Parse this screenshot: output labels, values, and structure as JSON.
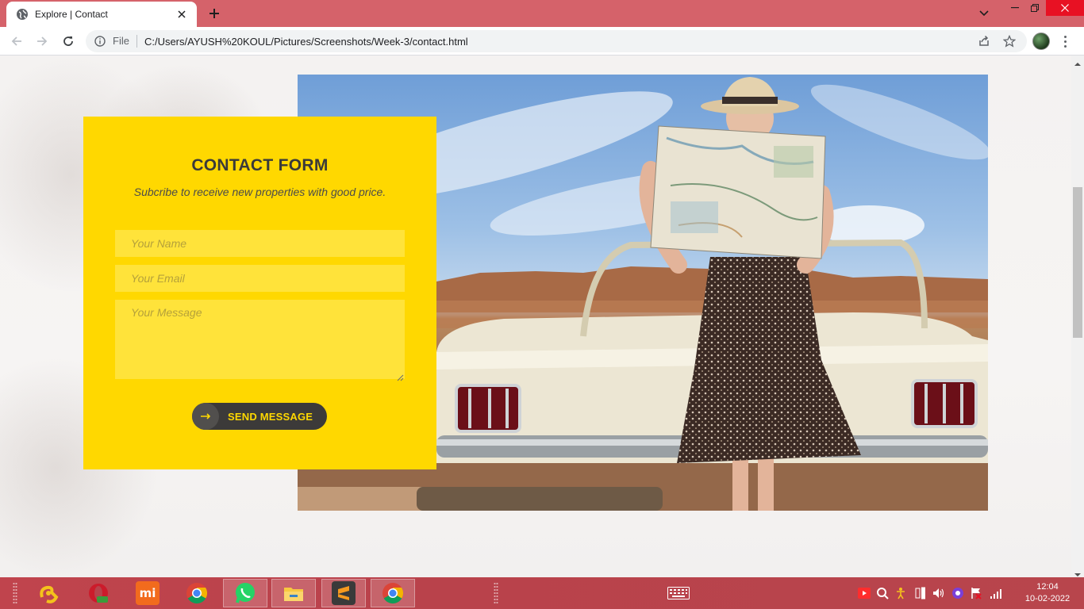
{
  "browser": {
    "tab_title": "Explore | Contact",
    "omnibox_scheme": "File",
    "url": "C:/Users/AYUSH%20KOUL/Pictures/Screenshots/Week-3/contact.html"
  },
  "contact_form": {
    "title": "CONTACT FORM",
    "subtitle": "Subcribe to receive new properties with good price.",
    "name_placeholder": "Your Name",
    "email_placeholder": "Your Email",
    "message_placeholder": "Your Message",
    "submit_label": "SEND MESSAGE",
    "accent_color": "#ffd800",
    "button_color": "#3c3a39"
  },
  "taskbar": {
    "apps": [
      "cheat-engine",
      "opera",
      "mi",
      "chrome",
      "whatsapp",
      "file-explorer",
      "sublime-text",
      "chrome"
    ],
    "time": "12:04",
    "date": "10-02-2022"
  }
}
